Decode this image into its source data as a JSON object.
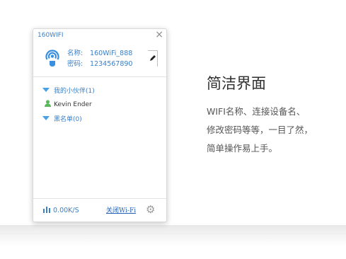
{
  "window": {
    "title": "160WIFI",
    "close_icon": "×"
  },
  "network": {
    "name_label": "名称:",
    "name_value": "160WiFi_888",
    "password_label": "密码:",
    "password_value": "1234567890"
  },
  "groups": {
    "partners_label": "我的小伙伴(1)",
    "members": [
      "Kevin Ender"
    ],
    "blacklist_label": "黑名单(0)"
  },
  "footer": {
    "speed": "0.00K/S",
    "close_wifi_label": "关闭Wi-Fi"
  },
  "promo": {
    "heading": "简洁界面",
    "lines": [
      "WIFI名称、连接设备名、",
      "修改密码等等，一目了然，",
      "简单操作易上手。"
    ]
  },
  "colors": {
    "accent": "#3a7fc8",
    "icon_blue": "#4aa0e4",
    "member_green": "#5cb85c"
  }
}
